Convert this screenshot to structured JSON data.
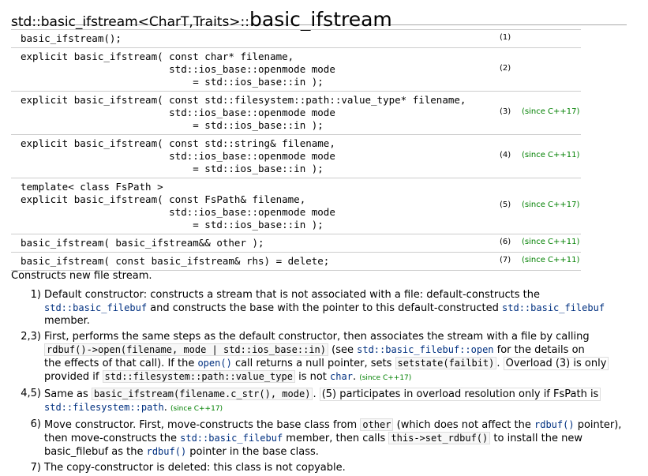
{
  "heading": {
    "prefix": "std::basic_ifstream<CharT,Traits>::",
    "name": "basic_ifstream"
  },
  "declarations": [
    {
      "lines": [
        "basic_ifstream();"
      ],
      "num": "(1)",
      "since": ""
    },
    {
      "lines": [
        "explicit basic_ifstream( const char* filename,",
        "                         std::ios_base::openmode mode",
        "                             = std::ios_base::in );"
      ],
      "num": "(2)",
      "since": ""
    },
    {
      "lines": [
        "explicit basic_ifstream( const std::filesystem::path::value_type* filename,",
        "                         std::ios_base::openmode mode",
        "                             = std::ios_base::in );"
      ],
      "num": "(3)",
      "since": "(since C++17)"
    },
    {
      "lines": [
        "explicit basic_ifstream( const std::string& filename,",
        "                         std::ios_base::openmode mode",
        "                             = std::ios_base::in );"
      ],
      "num": "(4)",
      "since": "(since C++11)"
    },
    {
      "lines": [
        "template< class FsPath >",
        "explicit basic_ifstream( const FsPath& filename,",
        "                         std::ios_base::openmode mode",
        "                             = std::ios_base::in );"
      ],
      "num": "(5)",
      "since": "(since C++17)"
    },
    {
      "lines": [
        "basic_ifstream( basic_ifstream&& other );"
      ],
      "num": "(6)",
      "since": "(since C++11)"
    },
    {
      "lines": [
        "basic_ifstream( const basic_ifstream& rhs) = delete;"
      ],
      "num": "(7)",
      "since": "(since C++11)"
    }
  ],
  "intro": "Constructs new file stream.",
  "items": {
    "i1": {
      "num": "1)",
      "t1": "Default constructor: constructs a stream that is not associated with a file: default-constructs the",
      "link1": "std::basic_filebuf",
      "t2": " and constructs the base with the pointer to this default-constructed ",
      "link2": "std::basic_filebuf",
      "t3": "member."
    },
    "i2": {
      "num": "2,3)",
      "t1": "First, performs the same steps as the default constructor, then associates the stream with a file by calling",
      "code1": "rdbuf()->open(filename, mode | std::ios_base::in)",
      "t2": " (see ",
      "link1": "std::basic_filebuf::open",
      "t3": " for the details on",
      "t4": "the effects of that call). If the ",
      "link2": "open()",
      "t5": " call returns a null pointer, sets ",
      "code2": "setstate(failbit)",
      "t6": ". ",
      "t7": "Overload (3) is only",
      "t8": "provided if ",
      "code3": "std::filesystem::path::value_type",
      "t9": " is not ",
      "link3": "char",
      "t10": ". ",
      "since": "(since C++17)"
    },
    "i3": {
      "num": "4,5)",
      "t1": "Same as ",
      "code1": "basic_ifstream(filename.c_str(), mode)",
      "t2": ". ",
      "t3": "(5) participates in overload resolution only if FsPath is",
      "link1": "std::filesystem::path",
      "t4": ". ",
      "since": "(since C++17)"
    },
    "i4": {
      "num": "6)",
      "t1": "Move constructor. First, move-constructs the base class from ",
      "code1": "other",
      "t2": " (which does not affect the ",
      "link1": "rdbuf()",
      "t3": " pointer),",
      "t4": "then move-constructs the ",
      "link2": "std::basic_filebuf",
      "t5": " member, then calls ",
      "code2": "this->set_rdbuf()",
      "t6": " to install the new",
      "t7": "basic_filebuf as the ",
      "link3": "rdbuf()",
      "t8": " pointer in the base class."
    },
    "i5": {
      "num": "7)",
      "t1": "The copy-constructor is deleted: this class is not copyable."
    }
  }
}
